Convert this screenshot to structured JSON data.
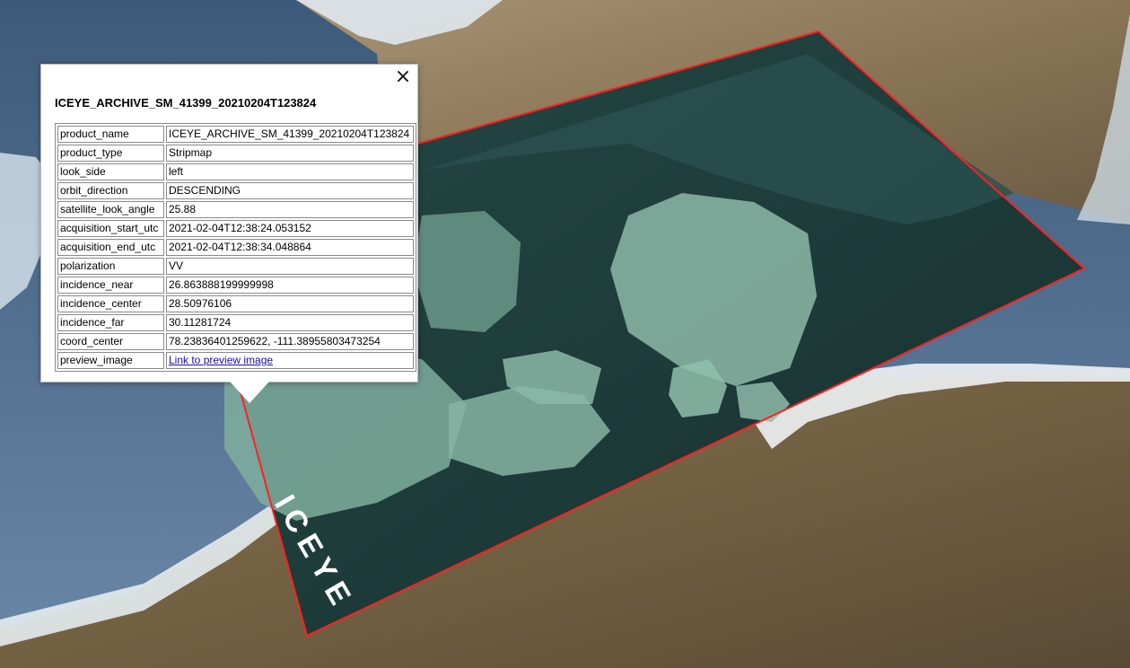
{
  "map": {
    "overlay_watermark": "ICEYE",
    "footprint_color": "#ff2020"
  },
  "popup": {
    "title": "ICEYE_ARCHIVE_SM_41399_20210204T123824",
    "close_label": "×",
    "rows": [
      {
        "key": "product_name",
        "value": "ICEYE_ARCHIVE_SM_41399_20210204T123824"
      },
      {
        "key": "product_type",
        "value": "Stripmap"
      },
      {
        "key": "look_side",
        "value": "left"
      },
      {
        "key": "orbit_direction",
        "value": "DESCENDING"
      },
      {
        "key": "satellite_look_angle",
        "value": "25.88"
      },
      {
        "key": "acquisition_start_utc",
        "value": "2021-02-04T12:38:24.053152"
      },
      {
        "key": "acquisition_end_utc",
        "value": "2021-02-04T12:38:34.048864"
      },
      {
        "key": "polarization",
        "value": "VV"
      },
      {
        "key": "incidence_near",
        "value": "26.863888199999998"
      },
      {
        "key": "incidence_center",
        "value": "28.50976106"
      },
      {
        "key": "incidence_far",
        "value": "30.11281724"
      },
      {
        "key": "coord_center",
        "value": "78.23836401259622, -111.38955803473254"
      },
      {
        "key": "preview_image",
        "value": "Link to preview image"
      }
    ]
  }
}
